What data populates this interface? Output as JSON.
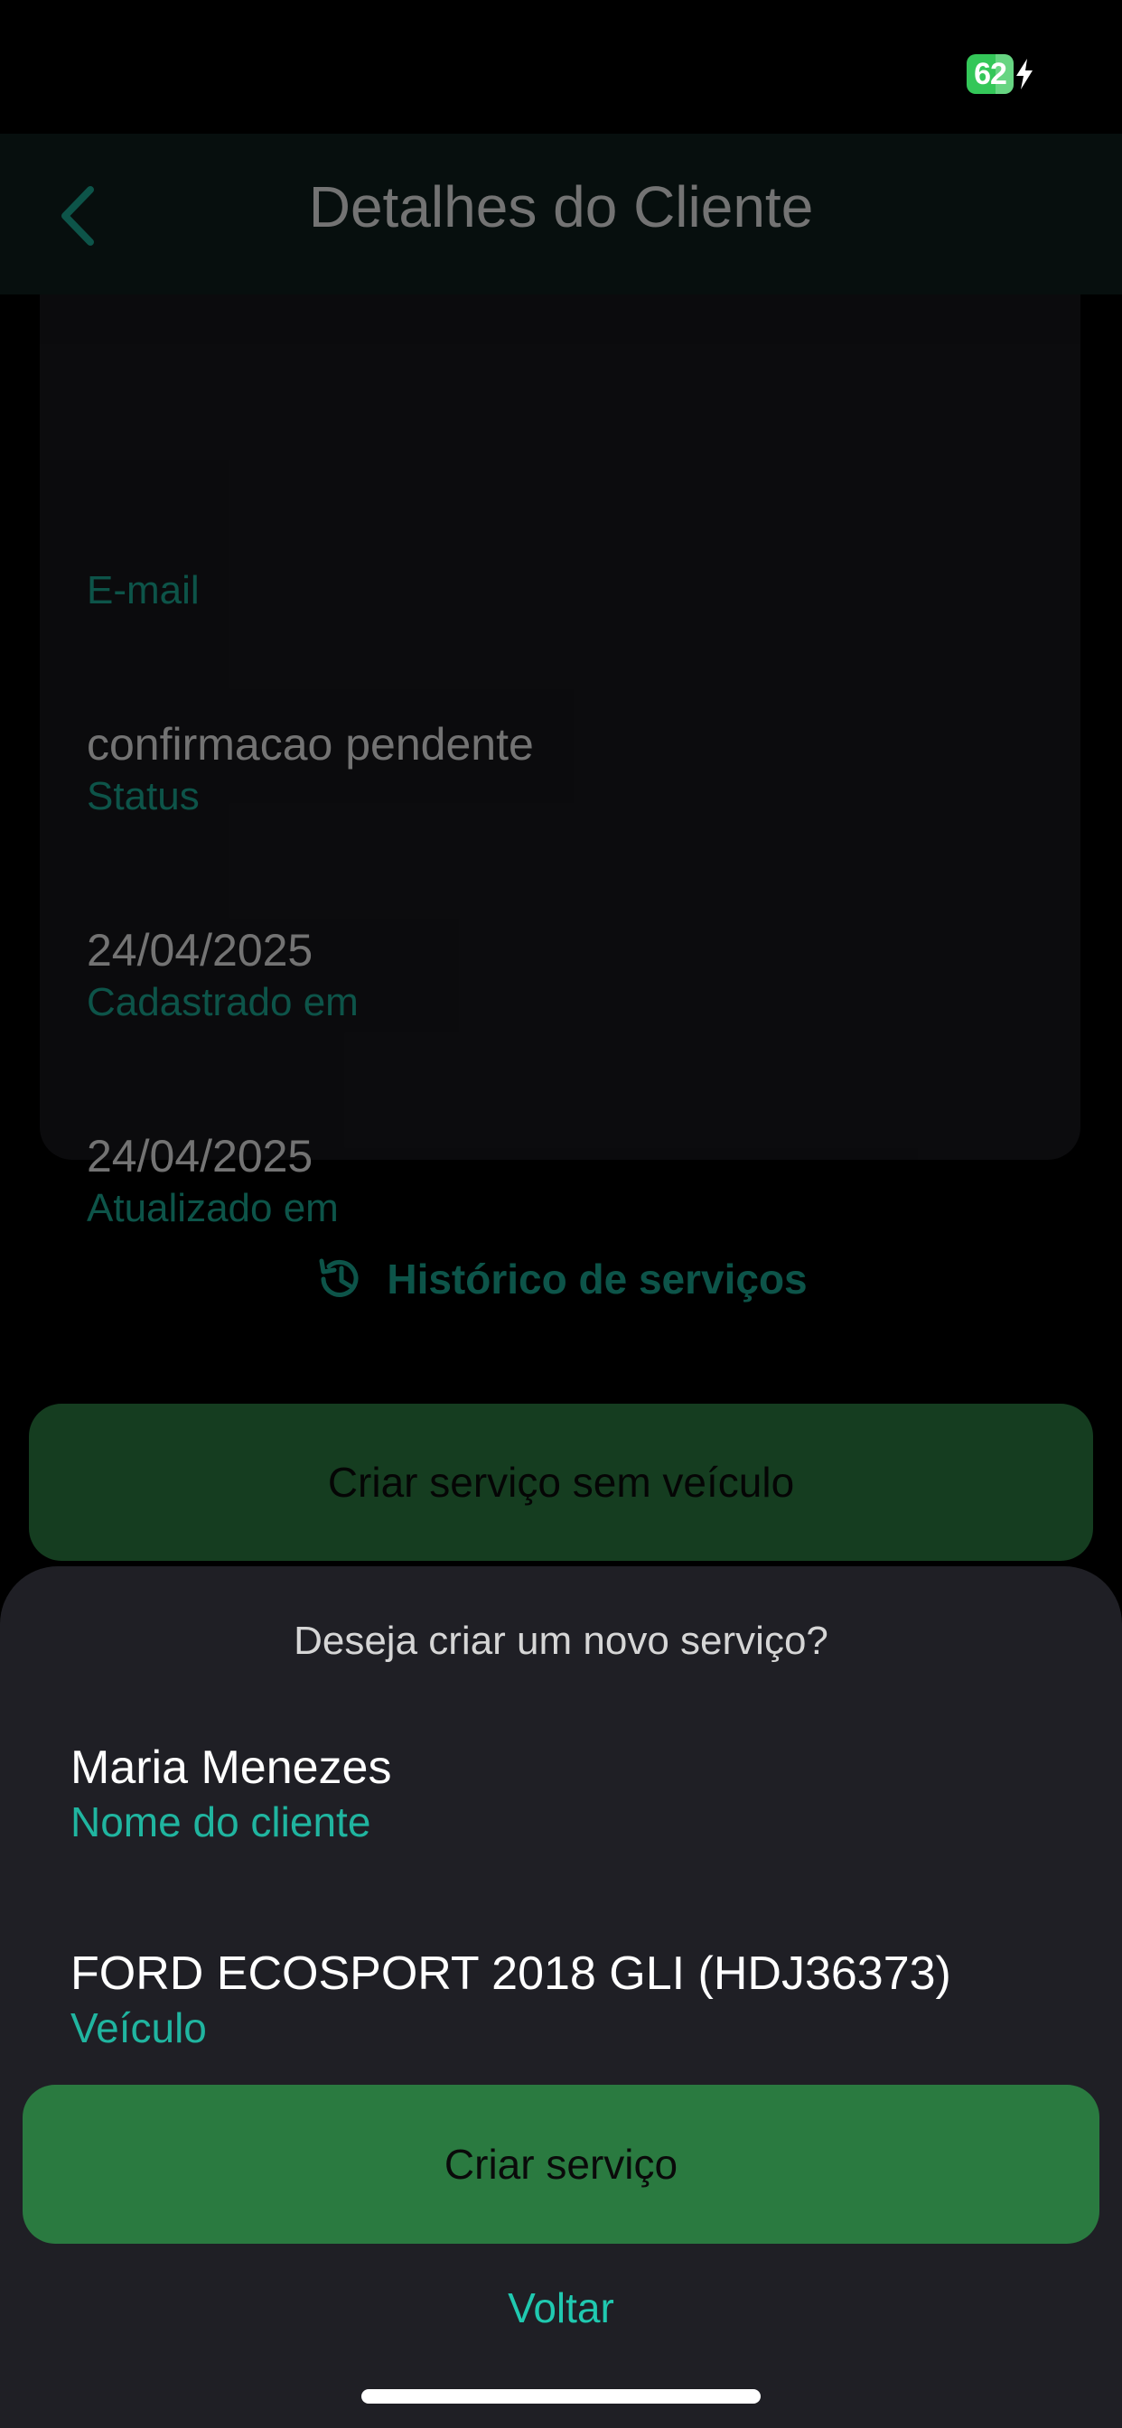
{
  "status_bar": {
    "battery_level": "62"
  },
  "header": {
    "title": "Detalhes do Cliente",
    "back_icon": "chevron-left-icon"
  },
  "client_details": {
    "email_label": "E-mail",
    "status_value": "confirmacao pendente",
    "status_label": "Status",
    "created_value": "24/04/2025",
    "created_label": "Cadastrado em",
    "updated_value": "24/04/2025",
    "updated_label": "Atualizado em"
  },
  "history": {
    "icon": "history-icon",
    "label": "Histórico de serviços"
  },
  "actions": {
    "no_vehicle_label": "Criar serviço sem veículo"
  },
  "sheet": {
    "title": "Deseja criar um novo serviço?",
    "client_name_value": "Maria Menezes",
    "client_name_label": "Nome do cliente",
    "vehicle_value": "FORD ECOSPORT 2018 GLI (HDJ36373)",
    "vehicle_label": "Veículo",
    "create_label": "Criar serviço",
    "back_label": "Voltar"
  },
  "colors": {
    "accent_teal": "#1aa791",
    "button_green": "#2a7a40",
    "battery_green": "#34c759",
    "sheet_bg": "#1f1f25"
  }
}
